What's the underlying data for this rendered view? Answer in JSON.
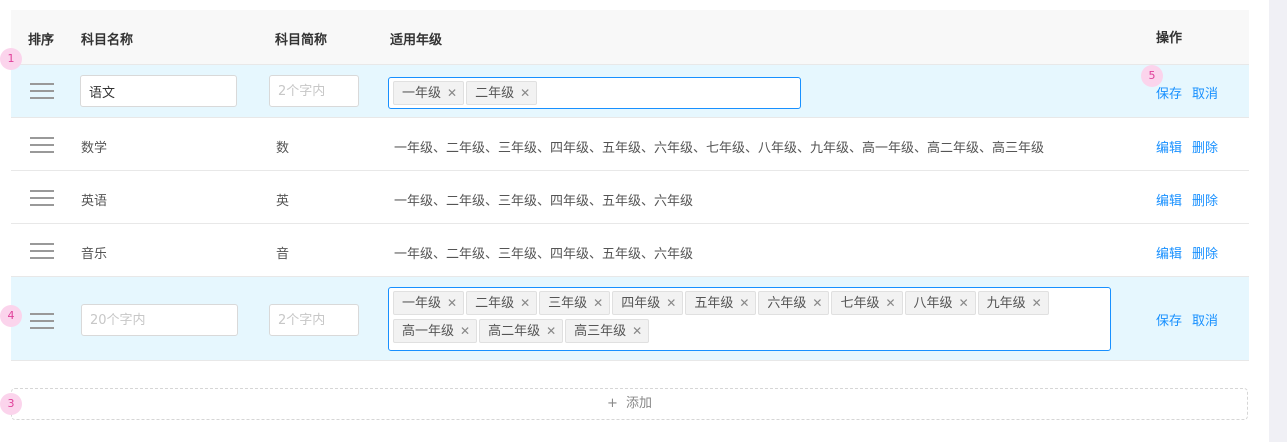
{
  "table": {
    "headers": {
      "order": "排序",
      "name": "科目名称",
      "short": "科目简称",
      "grades": "适用年级",
      "actions": "操作"
    },
    "rows": [
      {
        "mode": "edit",
        "name_value": "语文",
        "name_placeholder": "",
        "short_value": "",
        "short_placeholder": "2个字内",
        "tags": [
          "一年级",
          "二年级"
        ],
        "actions": [
          "保存",
          "取消"
        ]
      },
      {
        "mode": "view",
        "name": "数学",
        "short": "数",
        "grades": "一年级、二年级、三年级、四年级、五年级、六年级、七年级、八年级、九年级、高一年级、高二年级、高三年级",
        "actions": [
          "编辑",
          "删除"
        ]
      },
      {
        "mode": "view",
        "name": "英语",
        "short": "英",
        "grades": "一年级、二年级、三年级、四年级、五年级、六年级",
        "actions": [
          "编辑",
          "删除"
        ]
      },
      {
        "mode": "view",
        "name": "音乐",
        "short": "音",
        "grades": "一年级、二年级、三年级、四年级、五年级、六年级",
        "actions": [
          "编辑",
          "删除"
        ]
      },
      {
        "mode": "edit",
        "name_value": "",
        "name_placeholder": "20个字内",
        "short_value": "",
        "short_placeholder": "2个字内",
        "tags": [
          "一年级",
          "二年级",
          "三年级",
          "四年级",
          "五年级",
          "六年级",
          "七年级",
          "八年级",
          "九年级",
          "高一年级",
          "高二年级",
          "高三年级"
        ],
        "actions": [
          "保存",
          "取消"
        ]
      }
    ]
  },
  "tag_remove_symbol": "✕",
  "add_button": {
    "plus": "+",
    "label": "添加"
  },
  "badges": [
    "1",
    "5",
    "4",
    "3"
  ],
  "colors": {
    "accent": "#1890ff",
    "edit_row_bg": "#e6f7fe",
    "badge_bg": "#fbd4ec",
    "badge_text": "#e0409a"
  }
}
